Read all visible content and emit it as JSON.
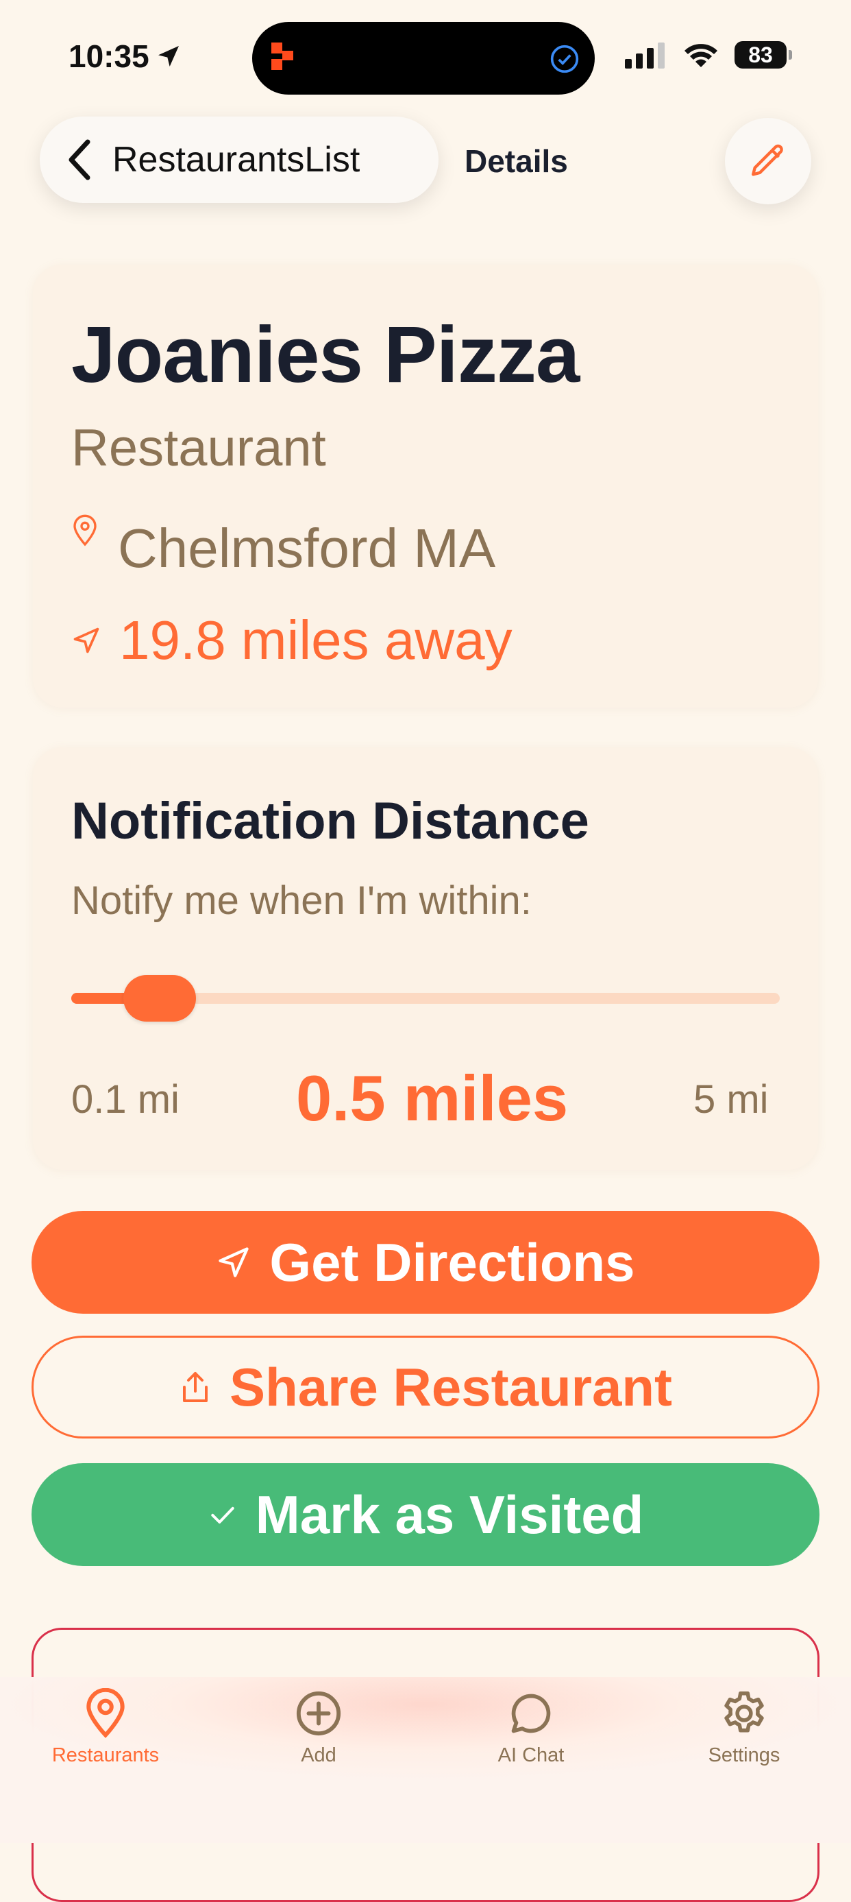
{
  "status_bar": {
    "time": "10:35",
    "battery": "83"
  },
  "nav": {
    "back_label": "RestaurantsList",
    "title": "Details"
  },
  "restaurant": {
    "name": "Joanies Pizza",
    "type": "Restaurant",
    "location": "Chelmsford MA",
    "distance": "19.8 miles away"
  },
  "notification": {
    "title": "Notification Distance",
    "subtitle": "Notify me when I'm within:",
    "min_label": "0.1 mi",
    "max_label": "5 mi",
    "value_label": "0.5 miles",
    "slider": {
      "min": 0.1,
      "max": 5,
      "value": 0.5
    }
  },
  "buttons": {
    "directions": "Get Directions",
    "share": "Share Restaurant",
    "visited": "Mark as Visited"
  },
  "tabs": [
    {
      "label": "Restaurants",
      "icon": "map-pin-icon",
      "active": true
    },
    {
      "label": "Add",
      "icon": "plus-circle-icon",
      "active": false
    },
    {
      "label": "AI Chat",
      "icon": "chat-bubble-icon",
      "active": false
    },
    {
      "label": "Settings",
      "icon": "gear-icon",
      "active": false
    }
  ],
  "colors": {
    "accent": "#FF6B35",
    "success": "#48BB78",
    "background": "#FDF6EC",
    "muted_text": "#8B7355",
    "danger_border": "#D9304A"
  }
}
